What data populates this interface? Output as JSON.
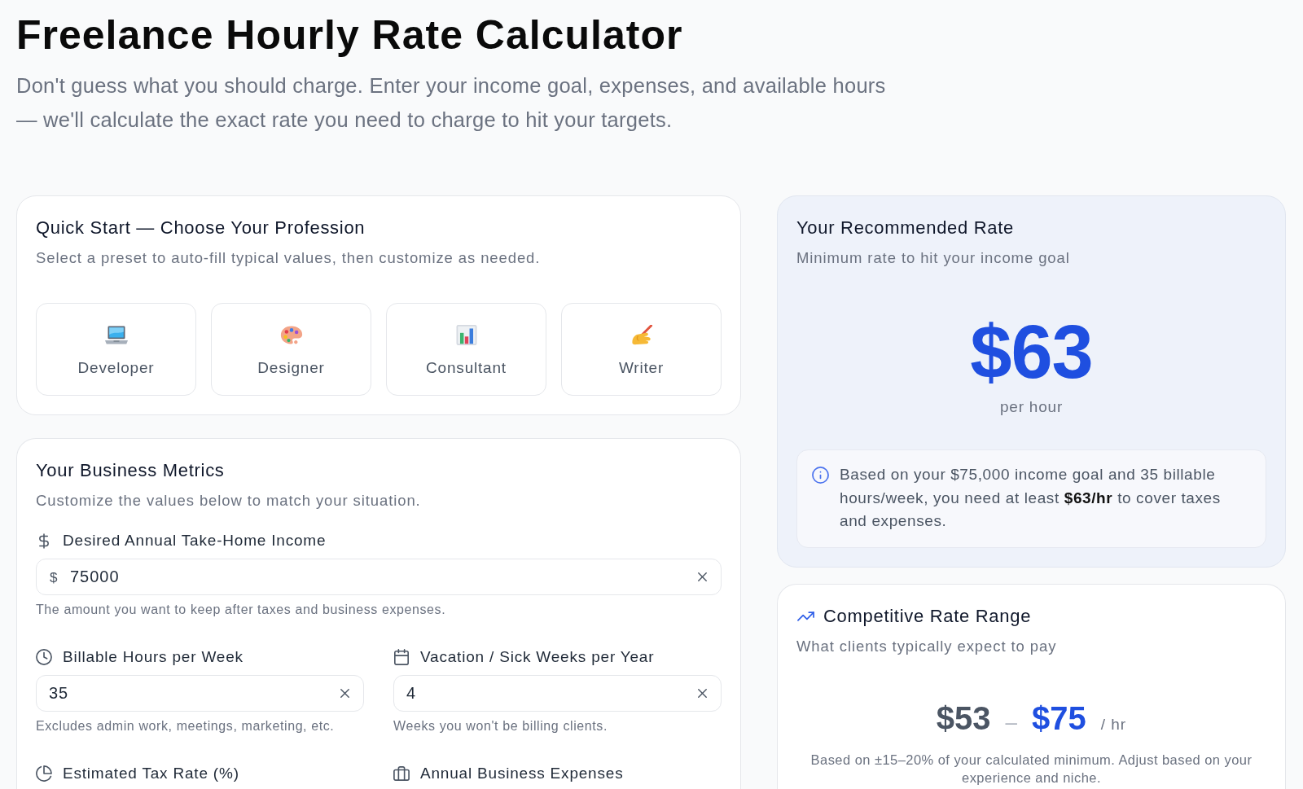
{
  "header": {
    "title": "Freelance Hourly Rate Calculator",
    "subtitle": "Don't guess what you should charge. Enter your income goal, expenses, and available hours — we'll calculate the exact rate you need to charge to hit your targets."
  },
  "quick_start": {
    "title": "Quick Start — Choose Your Profession",
    "subtitle": "Select a preset to auto-fill typical values, then customize as needed.",
    "presets": [
      {
        "label": "Developer",
        "selected": false
      },
      {
        "label": "Designer",
        "selected": false
      },
      {
        "label": "Consultant",
        "selected": false
      },
      {
        "label": "Writer",
        "selected": false
      }
    ]
  },
  "business_metrics": {
    "title": "Your Business Metrics",
    "subtitle": "Customize the values below to match your situation.",
    "fields": [
      {
        "label": "Desired Annual Take-Home Income",
        "prefix": "$",
        "value": "75000",
        "help": "The amount you want to keep after taxes and business expenses."
      },
      {
        "label": "Billable Hours per Week",
        "value": "35",
        "help": "Excludes admin work, meetings, marketing, etc."
      },
      {
        "label": "Vacation / Sick Weeks per Year",
        "value": "4",
        "help": "Weeks you won't be billing clients."
      },
      {
        "label": "Estimated Tax Rate (%)"
      },
      {
        "label": "Annual Business Expenses"
      }
    ]
  },
  "recommended_rate": {
    "title": "Your Recommended Rate",
    "subtitle": "Minimum rate to hit your income goal",
    "rate": "$63",
    "unit": "per hour",
    "note": "Based on your $75,000 income goal and 35 billable hours/week, you need at least **$63/hr** to cover taxes and expenses."
  },
  "rate_range": {
    "title": "Competitive Rate Range",
    "subtitle": "What clients typically expect to pay",
    "low": "$53",
    "separator": "–",
    "high": "$75",
    "unit": "/ hr",
    "note": "Based on ±15–20% of your calculated minimum. Adjust based on your experience and niche."
  }
}
